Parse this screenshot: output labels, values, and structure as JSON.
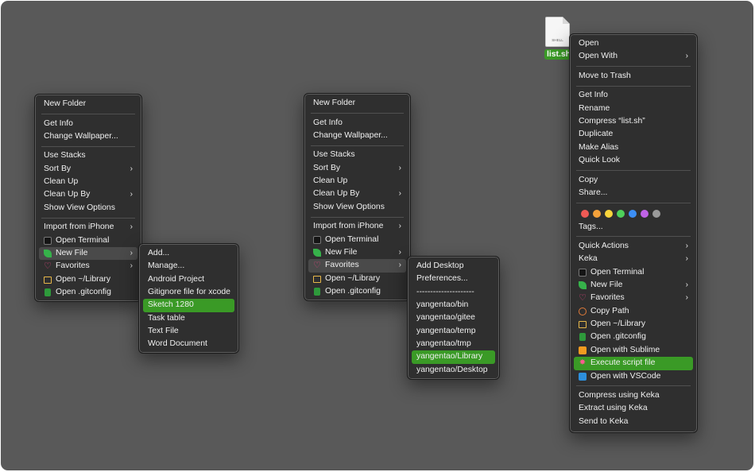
{
  "desktop_file": {
    "name": "list.sh",
    "icon_label": "SHELL"
  },
  "menu1": {
    "sections": [
      [
        {
          "label": "New Folder"
        }
      ],
      [
        {
          "label": "Get Info"
        },
        {
          "label": "Change Wallpaper..."
        }
      ],
      [
        {
          "label": "Use Stacks"
        },
        {
          "label": "Sort By"
        },
        {
          "label": "Clean Up"
        },
        {
          "label": "Clean Up By"
        },
        {
          "label": "Show View Options"
        }
      ],
      [
        {
          "label": "Import from iPhone"
        },
        {
          "label": "Open Terminal"
        },
        {
          "label": "New File"
        },
        {
          "label": "Favorites"
        },
        {
          "label": "Open ~/Library"
        },
        {
          "label": "Open .gitconfig"
        }
      ]
    ]
  },
  "submenu_newfile": {
    "items": [
      {
        "label": "Add..."
      },
      {
        "label": "Manage..."
      },
      {
        "label": "Android Project"
      },
      {
        "label": "Gitignore file  for xcode"
      },
      {
        "label": "Sketch 1280"
      },
      {
        "label": "Task table"
      },
      {
        "label": "Text File"
      },
      {
        "label": "Word Document"
      }
    ]
  },
  "menu2": {
    "sections": [
      [
        {
          "label": "New Folder"
        }
      ],
      [
        {
          "label": "Get Info"
        },
        {
          "label": "Change Wallpaper..."
        }
      ],
      [
        {
          "label": "Use Stacks"
        },
        {
          "label": "Sort By"
        },
        {
          "label": "Clean Up"
        },
        {
          "label": "Clean Up By"
        },
        {
          "label": "Show View Options"
        }
      ],
      [
        {
          "label": "Import from iPhone"
        },
        {
          "label": "Open Terminal"
        },
        {
          "label": "New File"
        },
        {
          "label": "Favorites"
        },
        {
          "label": "Open ~/Library"
        },
        {
          "label": "Open .gitconfig"
        }
      ]
    ]
  },
  "submenu_favorites": {
    "items": [
      {
        "label": "Add Desktop"
      },
      {
        "label": "Preferences..."
      },
      {
        "label": "---------------------"
      },
      {
        "label": "yangentao/bin"
      },
      {
        "label": "yangentao/gitee"
      },
      {
        "label": "yangentao/temp"
      },
      {
        "label": "yangentao/tmp"
      },
      {
        "label": "yangentao/Library"
      },
      {
        "label": "yangentao/Desktop"
      }
    ]
  },
  "menu3": {
    "items": [
      {
        "label": "Open"
      },
      {
        "label": "Open With"
      },
      {
        "label": "Move to Trash"
      },
      {
        "label": "Get Info"
      },
      {
        "label": "Rename"
      },
      {
        "label": "Compress “list.sh”"
      },
      {
        "label": "Duplicate"
      },
      {
        "label": "Make Alias"
      },
      {
        "label": "Quick Look"
      },
      {
        "label": "Copy"
      },
      {
        "label": "Share..."
      },
      {
        "label": "Tags..."
      },
      {
        "label": "Quick Actions"
      },
      {
        "label": "Keka"
      },
      {
        "label": "Open Terminal"
      },
      {
        "label": "New File"
      },
      {
        "label": "Favorites"
      },
      {
        "label": "Copy Path"
      },
      {
        "label": "Open ~/Library"
      },
      {
        "label": "Open .gitconfig"
      },
      {
        "label": "Open with Sublime"
      },
      {
        "label": "Execute script file"
      },
      {
        "label": "Open with VSCode"
      },
      {
        "label": "Compress using Keka"
      },
      {
        "label": "Extract using Keka"
      },
      {
        "label": "Send to Keka"
      }
    ],
    "tag_colors": [
      "#ef5a55",
      "#f4a13a",
      "#f8d43b",
      "#4ed05a",
      "#3c8ff5",
      "#c063e6",
      "#9a9a9a"
    ]
  },
  "colors": {
    "highlight": "#3a9a26",
    "menu_bg": "#2f2f2f",
    "desktop": "#595959"
  }
}
